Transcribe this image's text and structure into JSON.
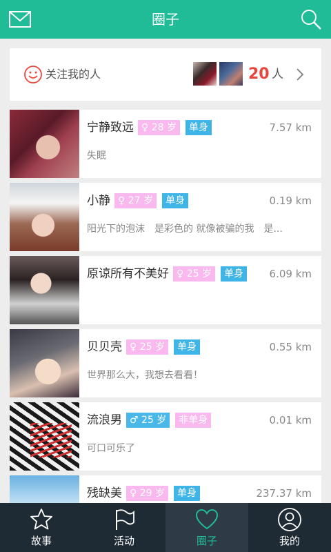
{
  "header": {
    "title": "圈子"
  },
  "followers": {
    "label": "关注我的人",
    "count": "20",
    "unit": "人"
  },
  "people": [
    {
      "name": "宁静致远",
      "gender": "female",
      "age": "♀ 28 岁",
      "status": "单身",
      "distance": "7.57 km",
      "signature": "失眠"
    },
    {
      "name": "小静",
      "gender": "female",
      "age": "♀ 27 岁",
      "status": "单身",
      "distance": "0.19 km",
      "signature": "阳光下的泡沫　是彩色的 就像被骗的我　是..."
    },
    {
      "name": "原谅所有不美好",
      "gender": "female",
      "age": "♀ 25 岁",
      "status": "单身",
      "distance": "6.09 km",
      "signature": ""
    },
    {
      "name": "贝贝壳",
      "gender": "female",
      "age": "♀ 25 岁",
      "status": "单身",
      "distance": "0.55 km",
      "signature": "世界那么大，我想去看看！"
    },
    {
      "name": "流浪男",
      "gender": "male",
      "age": "♂ 25 岁",
      "status": "非单身",
      "distance": "0.01 km",
      "signature": "可口可乐了"
    },
    {
      "name": "残缺美",
      "gender": "female",
      "age": "♀ 29 岁",
      "status": "单身",
      "distance": "237.37 km",
      "signature": ""
    }
  ],
  "tabs": [
    {
      "label": "故事",
      "icon": "star-icon",
      "active": false
    },
    {
      "label": "活动",
      "icon": "flag-icon",
      "active": false
    },
    {
      "label": "圈子",
      "icon": "heart-icon",
      "active": true
    },
    {
      "label": "我的",
      "icon": "profile-icon",
      "active": false
    }
  ],
  "colors": {
    "accent": "#1fbc97",
    "female_badge": "#f9b8ee",
    "male_badge": "#49b8e8",
    "single_badge": "#3fb4e6",
    "count": "#e8453c",
    "tabbar": "#1e2a34"
  }
}
